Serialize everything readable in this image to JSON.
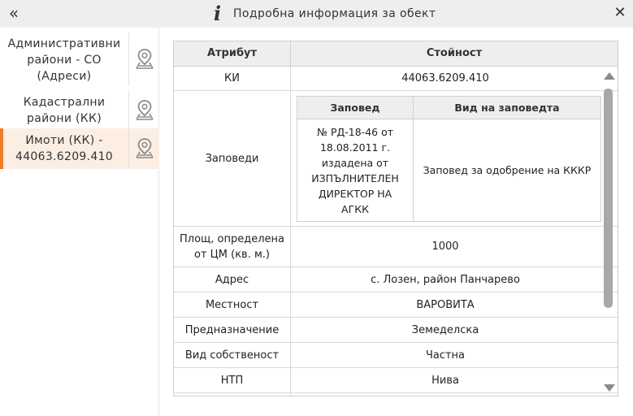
{
  "header": {
    "title": "Подробна информация за обект",
    "collapse_icon": "double-chevron-left-icon",
    "info_icon": "info-icon",
    "close_icon": "close-icon"
  },
  "sidebar": {
    "items": [
      {
        "label": "Административни райони - СО (Адреси)",
        "icon": "map-pin-icon",
        "active": false
      },
      {
        "label": "Кадастрални райони (КК)",
        "icon": "map-pin-icon",
        "active": false
      },
      {
        "label": "Имоти (КК) - 44063.6209.410",
        "icon": "map-pin-icon",
        "active": true
      }
    ],
    "accent_color": "#f07c2a"
  },
  "table": {
    "columns": [
      "Атрибут",
      "Стойност"
    ],
    "rows": [
      {
        "attr": "КИ",
        "value": "44063.6209.410"
      },
      {
        "attr": "Заповеди",
        "value": ""
      },
      {
        "attr": "Площ, определена от ЦМ (кв. м.)",
        "value": "1000"
      },
      {
        "attr": "Адрес",
        "value": "с. Лозен, район Панчарево"
      },
      {
        "attr": "Местност",
        "value": "ВАРОВИТА"
      },
      {
        "attr": "Предназначение",
        "value": "Земеделска"
      },
      {
        "attr": "Вид собственост",
        "value": "Частна"
      },
      {
        "attr": "НТП",
        "value": "Нива"
      }
    ],
    "orders": {
      "columns": [
        "Заповед",
        "Вид на заповедта"
      ],
      "rows": [
        {
          "order": "№ РД-18-46 от 18.08.2011 г. издадена от ИЗПЪЛНИТЕЛЕН ДИРЕКТОР НА АГКК",
          "type": "Заповед за одобрение на КККР"
        }
      ]
    }
  }
}
